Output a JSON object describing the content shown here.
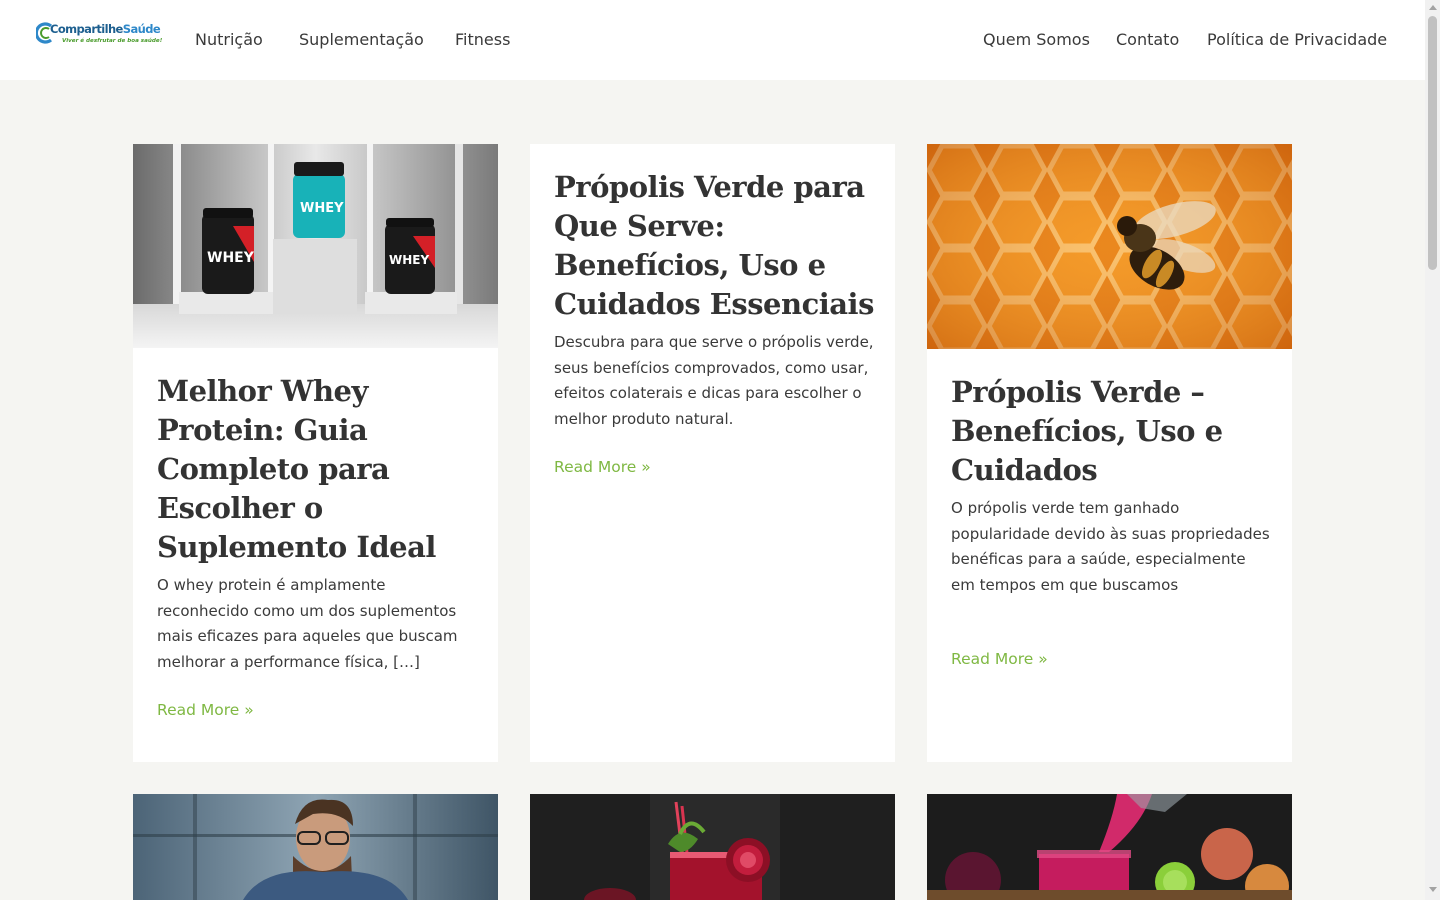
{
  "header": {
    "logo": {
      "name": "Compartilhe",
      "name_accent": "Saúde",
      "tagline": "Viver é desfrutar de boa saúde!"
    },
    "nav_left": [
      "Nutrição",
      "Suplementação",
      "Fitness"
    ],
    "nav_right": [
      "Quem Somos",
      "Contato",
      "Política de Privacidade"
    ]
  },
  "posts": [
    {
      "title": "Melhor Whey Protein: Guia Completo para Escolher o Suplemento Ideal",
      "excerpt": "O whey protein é amplamente reconhecido como um dos suplementos mais eficazes para aqueles que buscam melhorar a performance física, […]",
      "read_more": "Read More »",
      "image_icon": "whey-protein-image",
      "image_labels": [
        "WHEY",
        "WHEY",
        "WHEY"
      ]
    },
    {
      "title": "Própolis Verde para Que Serve: Benefícios, Uso e Cuidados Essenciais",
      "excerpt": "Descubra para que serve o própolis verde, seus benefícios comprovados, como usar, efeitos colaterais e dicas para escolher o melhor produto natural.",
      "read_more": "Read More »"
    },
    {
      "title": "Própolis Verde – Benefícios, Uso e Cuidados",
      "excerpt": "O própolis verde tem ganhado popularidade devido às suas propriedades benéficas para a saúde, especialmente em tempos em que buscamos",
      "read_more": "Read More »",
      "image_icon": "bee-honeycomb-image"
    },
    {
      "image_icon": "tired-man-image"
    },
    {
      "image_icon": "beet-juice-image"
    },
    {
      "image_icon": "juice-pouring-image"
    }
  ],
  "colors": {
    "background": "#f5f5f2",
    "card": "#ffffff",
    "accent_link": "#7fb843",
    "title": "#333333",
    "logo_blue": "#1d5f8f",
    "logo_green": "#4a9b2c"
  }
}
